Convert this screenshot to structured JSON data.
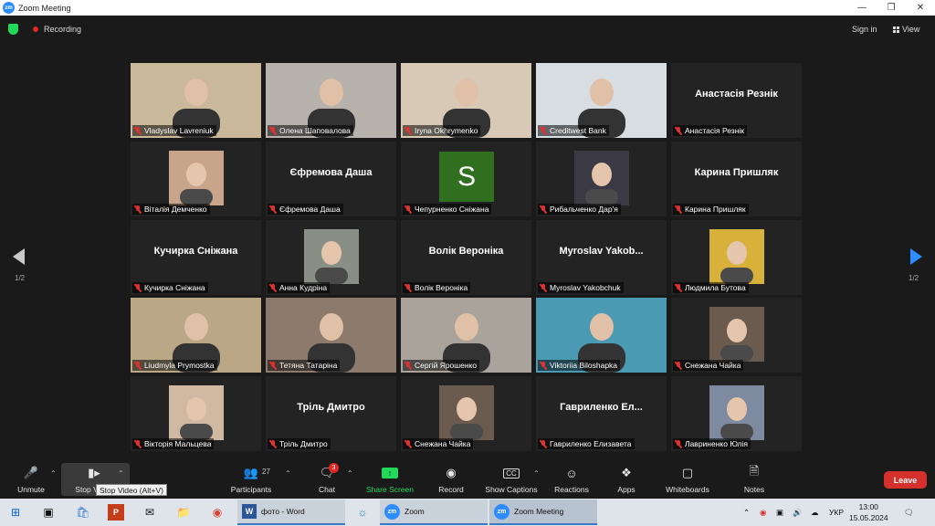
{
  "window": {
    "title": "Zoom Meeting",
    "logo_text": "zm"
  },
  "topbar": {
    "recording_label": "Recording",
    "signin_label": "Sign in",
    "view_label": "View"
  },
  "pagination": {
    "left": "1/2",
    "right": "1/2"
  },
  "participants": [
    {
      "name": "Vladyslav Lavreniuk",
      "type": "video",
      "bg": "#c9b99a"
    },
    {
      "name": "Олена Шаповалова",
      "type": "video",
      "bg": "#b8b2ad"
    },
    {
      "name": "Iryna Okhrymenko",
      "type": "video",
      "bg": "#d7c9b6"
    },
    {
      "name": "Creditwest Bank",
      "type": "video",
      "bg": "#d8dde2",
      "active": true
    },
    {
      "name": "Анастасія Резнік",
      "type": "name",
      "display": "Анастасія Резнік"
    },
    {
      "name": "Віталія Демченко",
      "type": "photo",
      "bg": "#c8a58a"
    },
    {
      "name": "Єфремова Даша",
      "type": "name",
      "display": "Єфремова Даша"
    },
    {
      "name": "Чепурненко Сніжана",
      "type": "avatar",
      "letter": "S"
    },
    {
      "name": "Рибальченко Дар'я",
      "type": "photo",
      "bg": "#3b3a44"
    },
    {
      "name": "Карина Пришляк",
      "type": "name",
      "display": "Карина Пришляк"
    },
    {
      "name": "Кучирка Сніжана",
      "type": "name",
      "display": "Кучирка Сніжана"
    },
    {
      "name": "Анна Кудріна",
      "type": "photo",
      "bg": "#8a8f86"
    },
    {
      "name": "Волік Вероніка",
      "type": "name",
      "display": "Волік Вероніка"
    },
    {
      "name": "Myroslav Yakobchuk",
      "type": "name",
      "display": "Myroslav  Yakob..."
    },
    {
      "name": "Людмила Бутова",
      "type": "photo",
      "bg": "#d8b13a"
    },
    {
      "name": "Liudmyla Prymostka",
      "type": "video",
      "bg": "#b9a786"
    },
    {
      "name": "Тетяна Татаріна",
      "type": "video",
      "bg": "#8c7b6c"
    },
    {
      "name": "Сергій Ярошенко",
      "type": "video",
      "bg": "#a9a39c"
    },
    {
      "name": "Viktoriia Biloshapka",
      "type": "video",
      "bg": "#4b9ab4"
    },
    {
      "name": "Снежана Чайка",
      "type": "photo",
      "bg": "#6b5b4e"
    },
    {
      "name": "Вікторія Мальцева",
      "type": "photo",
      "bg": "#d0b8a3"
    },
    {
      "name": "Тріль Дмитро",
      "type": "name",
      "display": "Тріль Дмитро"
    },
    {
      "name": "Снежана Чайка",
      "type": "photo",
      "bg": "#6b5b4e"
    },
    {
      "name": "Гавриленко Елизавета",
      "type": "name",
      "display": "Гавриленко  Ел..."
    },
    {
      "name": "Лавриненко Юлія",
      "type": "photo",
      "bg": "#7d8aa0"
    }
  ],
  "toolbar": {
    "unmute": "Unmute",
    "stop_video": "Stop Video",
    "participants": "Participants",
    "participants_count": "27",
    "chat": "Chat",
    "chat_badge": "3",
    "share_screen": "Share Screen",
    "record": "Record",
    "captions": "Show Captions",
    "reactions": "Reactions",
    "apps": "Apps",
    "whiteboards": "Whiteboards",
    "notes": "Notes",
    "leave": "Leave",
    "tooltip": "Stop Video (Alt+V)"
  },
  "taskbar": {
    "word_app": "фото - Word",
    "zoom_app": "Zoom",
    "zoom_meeting_app": "Zoom Meeting",
    "lang": "УКР",
    "time": "13:00",
    "date": "15.05.2024"
  }
}
